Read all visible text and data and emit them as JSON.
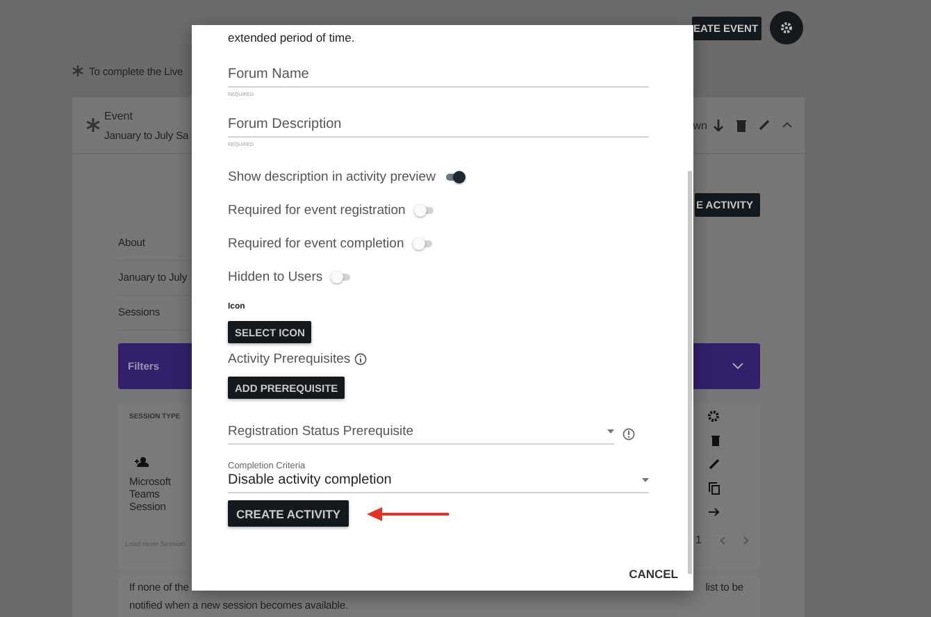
{
  "background": {
    "top_button": "EATE EVENT",
    "notice": "To complete the Live",
    "event": {
      "label": "Event",
      "name": "January to July Sa",
      "partial_action": "wn"
    },
    "activity_button": "E ACTIVITY",
    "details": [
      "About",
      "January to July",
      "Sessions"
    ],
    "filters": {
      "label": "Filters"
    },
    "sessions": {
      "column_1": "SESSION TYPE",
      "type": "Microsoft Teams Session",
      "load_more": "Load more Session",
      "page": "1"
    },
    "info": {
      "lines": [
        "If none of the",
        "notified when a new session becomes available."
      ],
      "right": "list to be"
    }
  },
  "dialog": {
    "intro": "extended period of time.",
    "fields": [
      {
        "placeholder": "Forum Name",
        "hint": "REQUIRED"
      },
      {
        "placeholder": "Forum Description",
        "hint": "REQUIRED"
      }
    ],
    "toggles": [
      {
        "label": "Show description in activity preview",
        "on": true
      },
      {
        "label": "Required for event registration",
        "on": false
      },
      {
        "label": "Required for event completion",
        "on": false
      },
      {
        "label": "Hidden to Users",
        "on": false
      }
    ],
    "icon_label": "Icon",
    "select_icon_button": "SELECT ICON",
    "prerequisites_label": "Activity Prerequisites",
    "add_prerequisite_button": "ADD PREREQUISITE",
    "registration_status": {
      "placeholder": "Registration Status Prerequisite"
    },
    "completion_criteria": {
      "label": "Completion Criteria",
      "value": "Disable activity completion"
    },
    "create_button": "CREATE ACTIVITY",
    "cancel_button": "CANCEL"
  }
}
